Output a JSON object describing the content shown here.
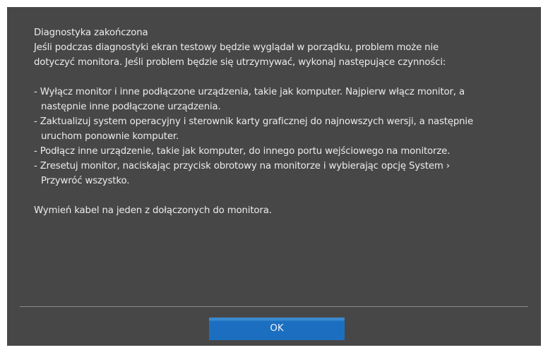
{
  "dialog": {
    "title": "Diagnostyka zakończona",
    "intro": [
      "Jeśli podczas diagnostyki ekran testowy będzie wyglądał w porządku, problem może nie",
      "dotyczyć monitora. Jeśli problem będzie się utrzymywać, wykonaj następujące czynności:"
    ],
    "steps": [
      {
        "line1": "- Wyłącz monitor i inne podłączone urządzenia, takie jak komputer. Najpierw włącz monitor, a",
        "line2": "następnie inne podłączone urządzenia."
      },
      {
        "line1": "- Zaktualizuj system operacyjny i sterownik karty graficznej do najnowszych wersji, a następnie",
        "line2": "uruchom ponownie komputer."
      },
      {
        "line1": "- Podłącz inne urządzenie, takie jak komputer, do innego portu wejściowego na monitorze."
      },
      {
        "line1": "- Zresetuj monitor, naciskając przycisk obrotowy na monitorze i wybierając opcję System ›",
        "line2": "Przywróć wszystko."
      }
    ],
    "footer_note": "Wymień kabel na jeden z dołączonych do monitora.",
    "ok_label": "OK"
  },
  "colors": {
    "dialog_background": "#474747",
    "text": "#ececec",
    "button": "#1c6fc0",
    "divider": "#8a8a8a"
  }
}
